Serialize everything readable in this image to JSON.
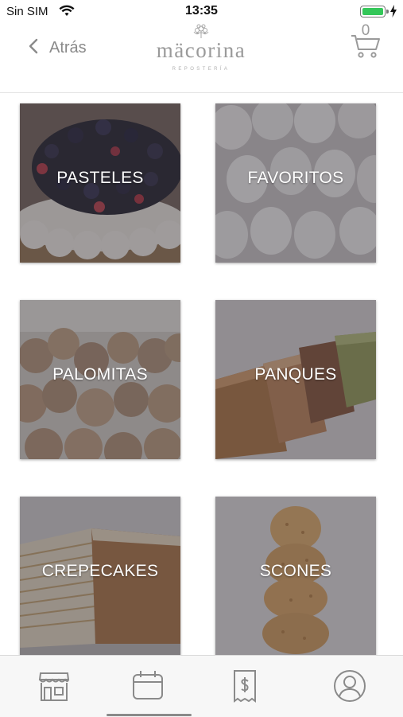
{
  "status": {
    "carrier": "Sin SIM",
    "time": "13:35"
  },
  "nav": {
    "back_label": "Atrás",
    "logo_text": "mäcorina",
    "logo_subtitle": "REPOSTERÍA",
    "cart_count": "0"
  },
  "categories": [
    {
      "label": "PASTELES"
    },
    {
      "label": "FAVORITOS"
    },
    {
      "label": "PALOMITAS"
    },
    {
      "label": "PANQUES"
    },
    {
      "label": "CREPECAKES"
    },
    {
      "label": "SCONES"
    }
  ],
  "tabs": [
    {
      "icon": "store-icon",
      "active": false
    },
    {
      "icon": "calendar-icon",
      "active": true
    },
    {
      "icon": "receipt-icon",
      "active": false
    },
    {
      "icon": "profile-icon",
      "active": false
    }
  ],
  "colors": {
    "accent_gray": "#8a8a8a",
    "battery_green": "#34c759",
    "tile_overlay": "#28262e"
  }
}
